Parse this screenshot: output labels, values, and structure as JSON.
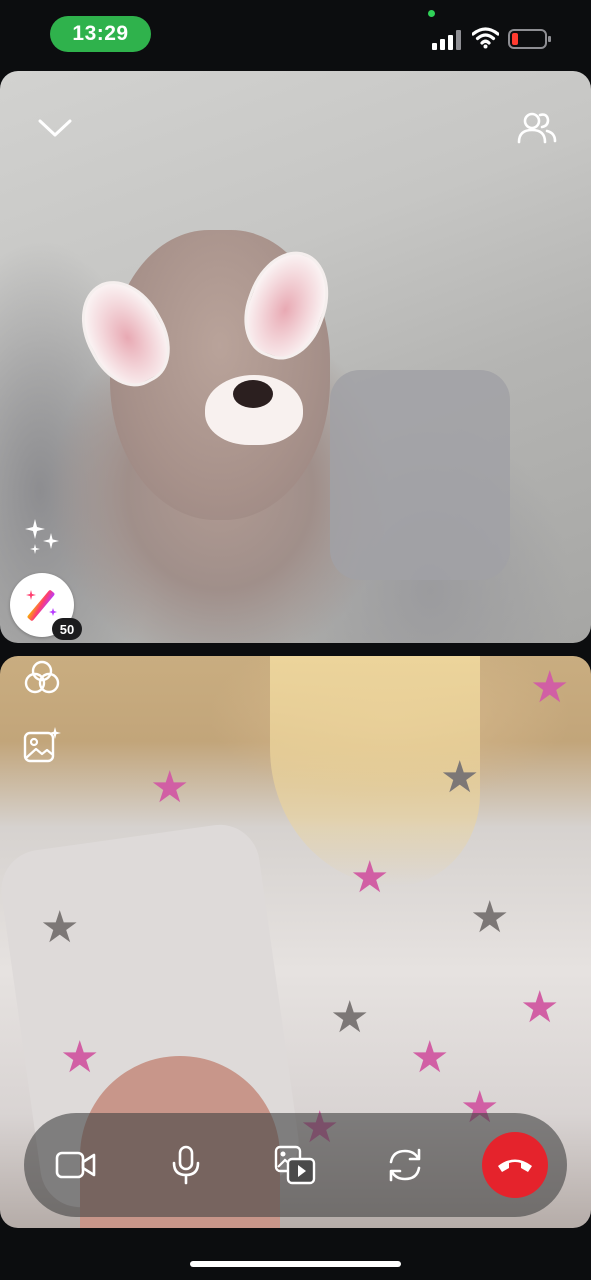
{
  "status_bar": {
    "time": "13:29",
    "time_pill_color": "#2fb24c",
    "camera_indicator_color": "#30d158",
    "battery_level_color": "#ff3b30",
    "icons": [
      "cellular-signal-icon",
      "wifi-icon",
      "battery-low-icon"
    ]
  },
  "top_video": {
    "controls": {
      "collapse_icon": "chevron-down-icon",
      "participants_icon": "people-icon",
      "effects_icon": "sparkles-icon",
      "magic_icon": "magic-wand-icon",
      "magic_badge": "50"
    }
  },
  "bottom_video": {
    "controls": {
      "filters_icon": "filters-icon",
      "backdrop_icon": "image-sparkle-icon"
    }
  },
  "call_controls": {
    "items": [
      "video-camera-icon",
      "microphone-icon",
      "media-share-icon",
      "flip-camera-icon",
      "end-call-icon"
    ],
    "end_call_color": "#e5232c"
  }
}
